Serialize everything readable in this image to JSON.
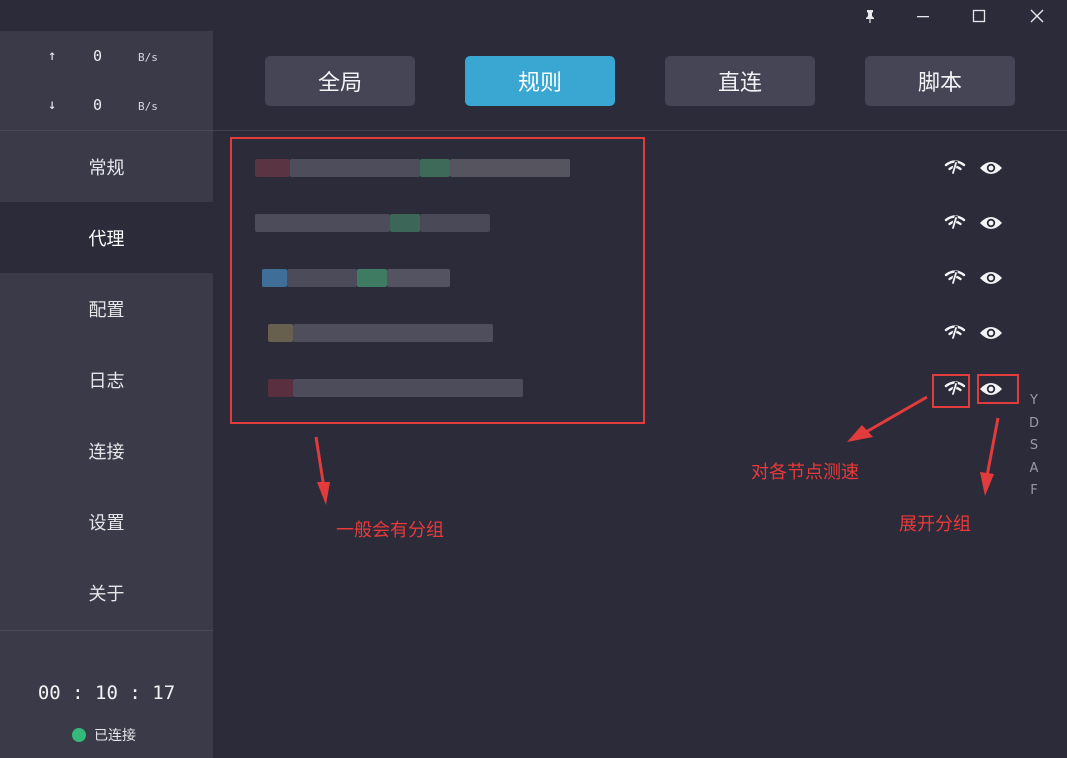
{
  "titlebar": {
    "icons": [
      "pin-icon",
      "minimize-icon",
      "maximize-icon",
      "close-icon"
    ]
  },
  "sidebar": {
    "traffic": {
      "up": {
        "arrow": "↑",
        "value": "0",
        "unit": "B/s"
      },
      "down": {
        "arrow": "↓",
        "value": "0",
        "unit": "B/s"
      }
    },
    "nav": [
      {
        "label": "常规"
      },
      {
        "label": "代理"
      },
      {
        "label": "配置"
      },
      {
        "label": "日志"
      },
      {
        "label": "连接"
      },
      {
        "label": "设置"
      },
      {
        "label": "关于"
      }
    ],
    "active_nav": "代理",
    "timer": "00 : 10 : 17",
    "status": "已连接"
  },
  "modes": [
    {
      "label": "全局"
    },
    {
      "label": "规则"
    },
    {
      "label": "直连"
    },
    {
      "label": "脚本"
    }
  ],
  "active_mode": "规则",
  "groups": [
    {
      "name_obscured": true
    },
    {
      "name_obscured": true
    },
    {
      "name_obscured": true
    },
    {
      "name_obscured": true
    },
    {
      "name_obscured": true
    }
  ],
  "index_letters": [
    "Y",
    "D",
    "S",
    "A",
    "F"
  ],
  "annotations": {
    "groups_note": "一般会有分组",
    "speedtest_note": "对各节点测速",
    "expand_note": "展开分组"
  },
  "colors": {
    "accent": "#3aa7d3",
    "annotation": "#e23b3b",
    "connected": "#35b97a",
    "sidebar_bg": "#3b3a49",
    "main_bg": "#2c2b3a"
  }
}
